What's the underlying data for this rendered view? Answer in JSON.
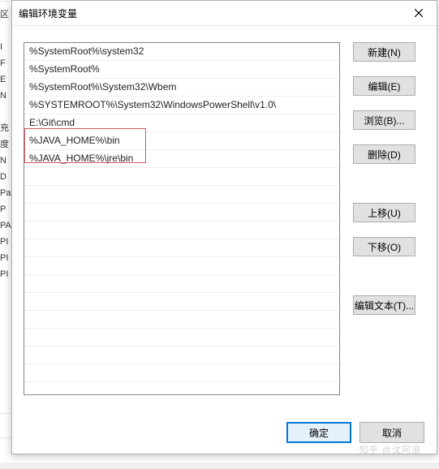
{
  "dialog": {
    "title": "编辑环境变量"
  },
  "list": {
    "items": [
      "%SystemRoot%\\system32",
      "%SystemRoot%",
      "%SystemRoot%\\System32\\Wbem",
      "%SYSTEMROOT%\\System32\\WindowsPowerShell\\v1.0\\",
      "E:\\Git\\cmd",
      "%JAVA_HOME%\\bin",
      "%JAVA_HOME%\\jre\\bin"
    ],
    "highlight_start_index": 5,
    "highlight_end_index": 6
  },
  "buttons": {
    "new": "新建(N)",
    "edit": "编辑(E)",
    "browse": "浏览(B)...",
    "delete": "删除(D)",
    "move_up": "上移(U)",
    "move_down": "下移(O)",
    "edit_text": "编辑文本(T)...",
    "ok": "确定",
    "cancel": "取消"
  },
  "watermark": "知乎 @沈阿浪",
  "bg_fragments": "区\n\nI\nF\nE\nN\n\n充\n度\nN\nD\nPa\nP\nPA\nPI\nPI\nPI"
}
